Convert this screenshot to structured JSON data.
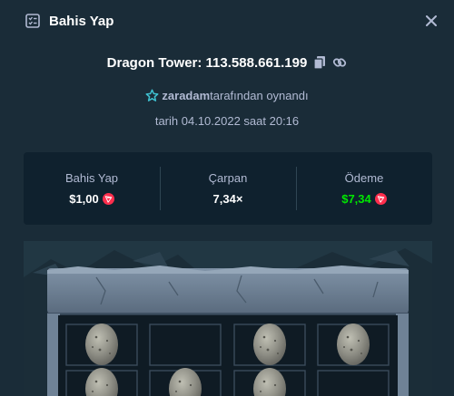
{
  "header": {
    "title": "Bahis Yap",
    "icon": "bet-slip-icon",
    "close_icon": "close-icon"
  },
  "game": {
    "title": "Dragon Tower: 113.588.661.199",
    "copy_icon": "copy-icon",
    "link_icon": "link-icon"
  },
  "player": {
    "name": "zaradam",
    "suffix": "tarafından oynandı",
    "icon": "star-icon"
  },
  "date": "tarih 04.10.2022 saat 20:16",
  "stats": {
    "bet": {
      "label": "Bahis Yap",
      "value": "$1,00",
      "currency_icon": "tron-icon"
    },
    "multiplier": {
      "label": "Çarpan",
      "value": "7,34×"
    },
    "payout": {
      "label": "Ödeme",
      "value": "$7,34",
      "currency_icon": "tron-icon"
    }
  },
  "colors": {
    "background": "#1a2c38",
    "panel": "#0f212e",
    "text_muted": "#b1bad3",
    "text_white": "#ffffff",
    "payout_green": "#00e701",
    "tron_red": "#ff2e4d"
  },
  "board": {
    "rows": [
      {
        "cells": [
          "egg",
          "empty",
          "egg",
          "egg"
        ]
      },
      {
        "cells": [
          "egg",
          "egg",
          "egg",
          "empty"
        ]
      }
    ]
  }
}
